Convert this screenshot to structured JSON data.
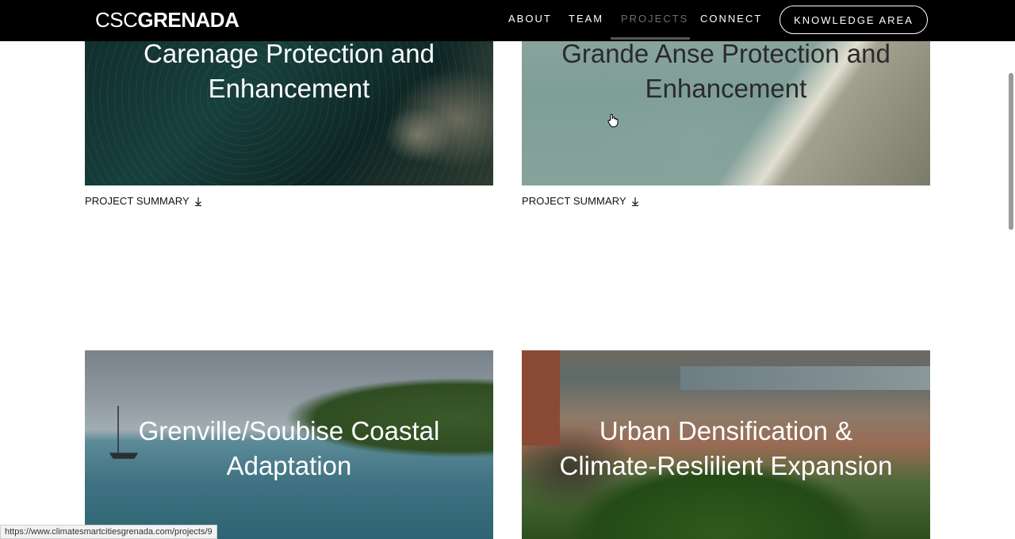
{
  "header": {
    "logo_part1": "CSC",
    "logo_part2": "GRENADA",
    "nav": [
      {
        "label": "ABOUT"
      },
      {
        "label": "TEAM"
      },
      {
        "label": "PROJECTS",
        "active": true
      },
      {
        "label": "CONNECT"
      }
    ],
    "cta_label": "KNOWLEDGE AREA"
  },
  "projects": [
    {
      "title_line1": "Carenage Protection and",
      "title_line2": "Enhancement",
      "summary_label": "PROJECT SUMMARY"
    },
    {
      "title_line1": "Grande Anse Protection and",
      "title_line2": "Enhancement",
      "summary_label": "PROJECT SUMMARY"
    },
    {
      "title_line1": "Grenville/Soubise Coastal",
      "title_line2": "Adaptation"
    },
    {
      "title_line1": "Urban Densification &",
      "title_line2": "Climate-Reslilient Expansion"
    }
  ],
  "status_bar": {
    "url": "https://www.climatesmartcitiesgrenada.com/projects/9"
  },
  "icons": {
    "download": "down-arrow-icon",
    "cursor": "hand-pointer-icon"
  },
  "colors": {
    "header_bg": "#000000",
    "nav_active": "#6d6d6d",
    "text": "#111111"
  }
}
